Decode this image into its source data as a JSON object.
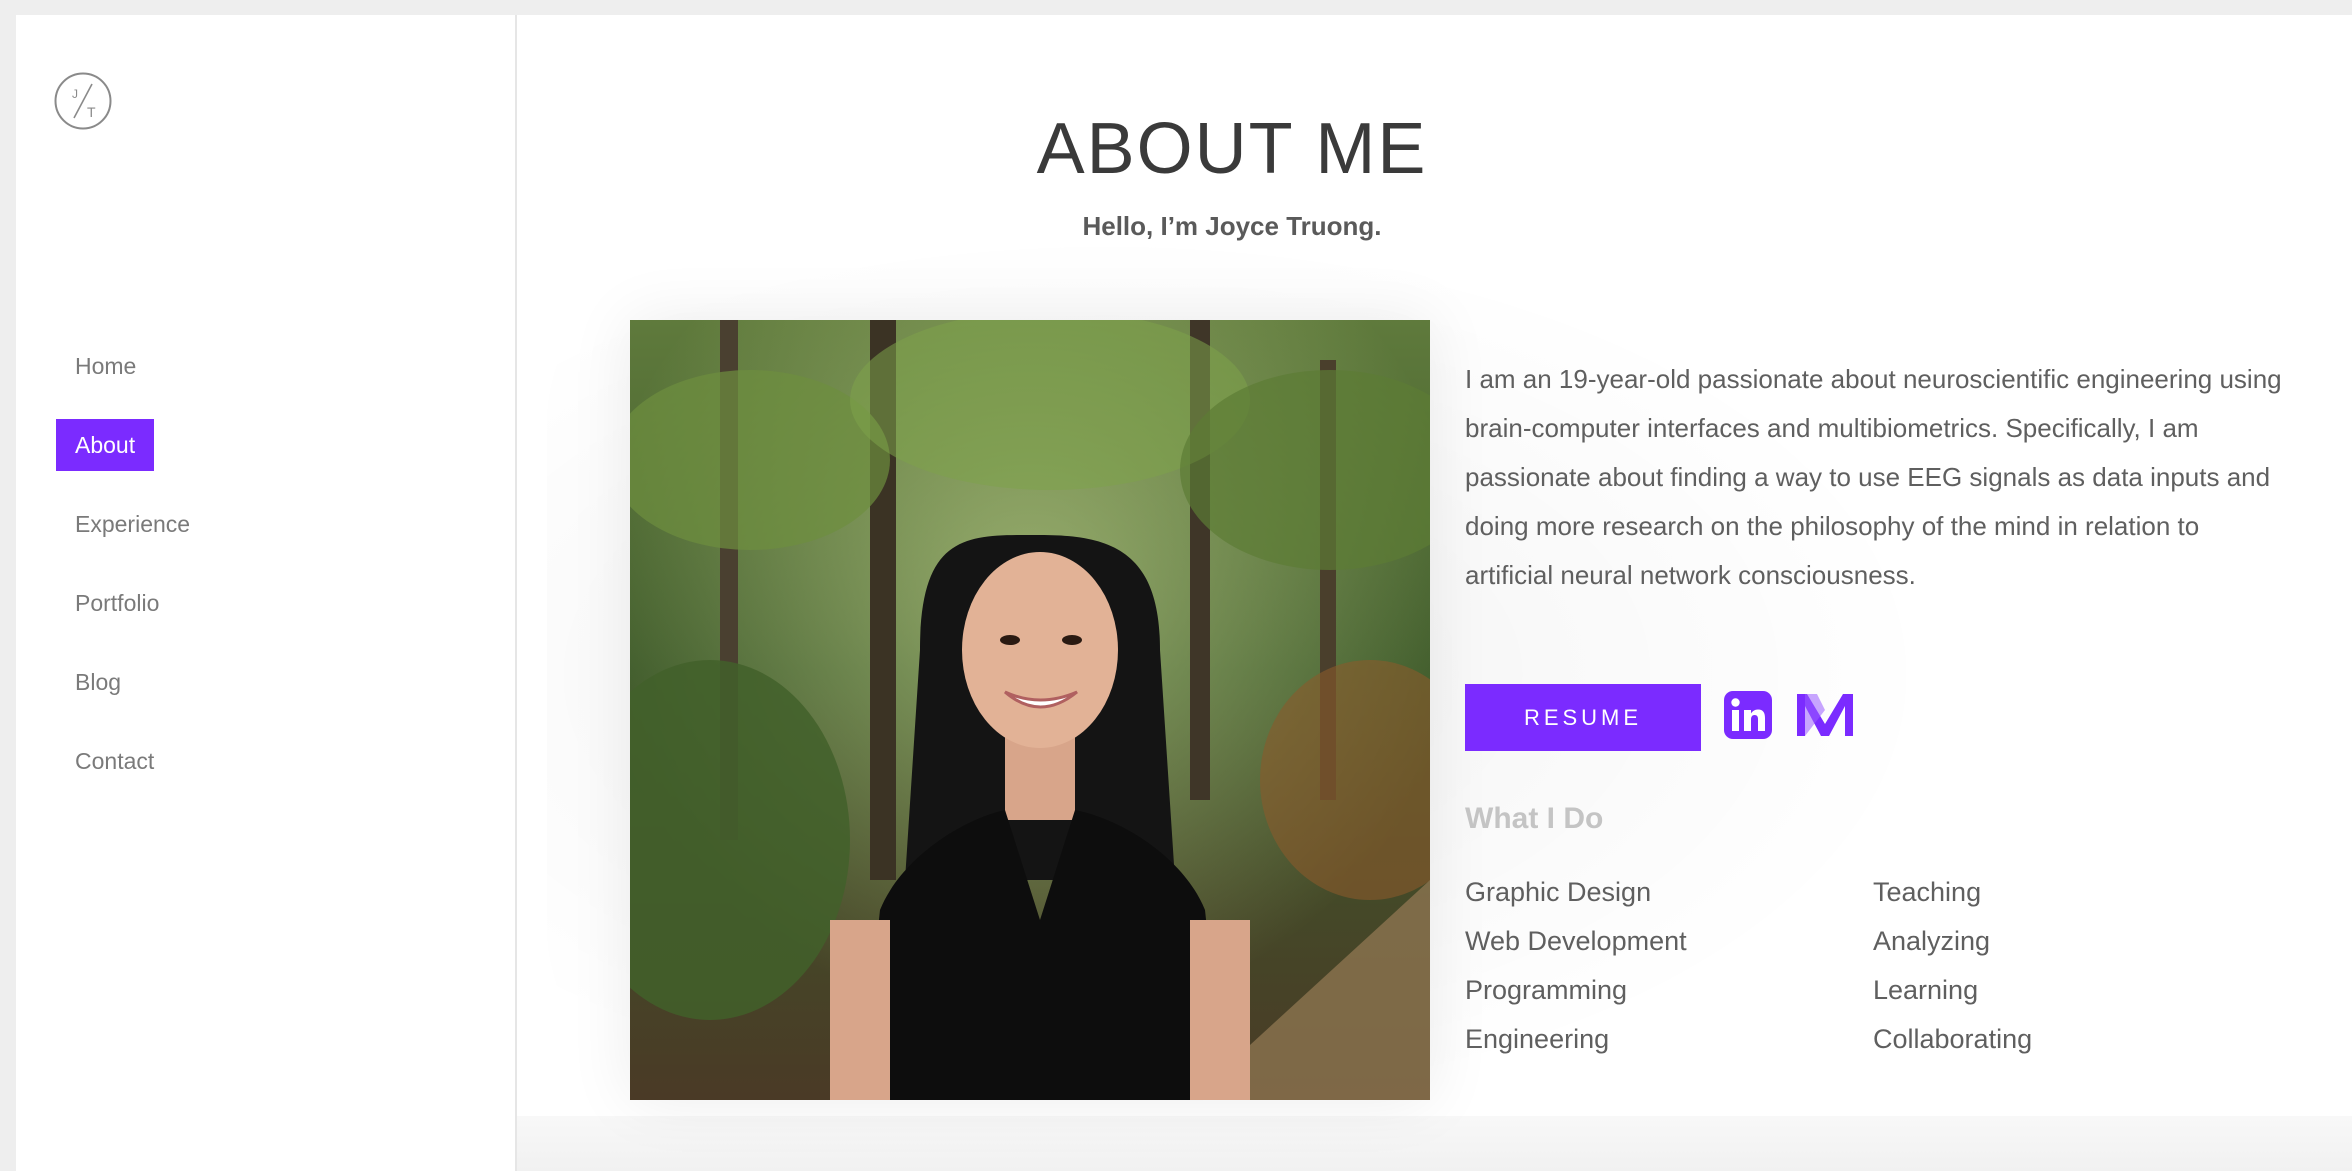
{
  "brand": {
    "logo_initials": [
      "J",
      "T"
    ]
  },
  "nav": {
    "items": [
      {
        "label": "Home"
      },
      {
        "label": "About",
        "active": true
      },
      {
        "label": "Experience"
      },
      {
        "label": "Portfolio"
      },
      {
        "label": "Blog"
      },
      {
        "label": "Contact"
      }
    ]
  },
  "about": {
    "title": "ABOUT ME",
    "greeting": "Hello, I’m Joyce Truong.",
    "bio": "I am an 19-year-old passionate about neuroscientific engineering using brain-computer interfaces and multibiometrics. Specifically, I am passionate about finding a way to use EEG signals as data inputs and doing more research on the philosophy of the mind in relation to artificial neural network consciousness.",
    "resume_label": "RESUME",
    "social_icons": [
      "linkedin-icon",
      "medium-icon"
    ],
    "what_i_do_title": "What I Do",
    "skills": [
      [
        "Graphic Design",
        "Teaching"
      ],
      [
        "Web Development",
        "Analyzing"
      ],
      [
        "Programming",
        "Learning"
      ],
      [
        "Engineering",
        "Collaborating"
      ]
    ]
  },
  "colors": {
    "accent": "#7b2bff",
    "nav_text": "#7a7a7a",
    "body_text": "#5f5f5f",
    "muted_heading": "#c4c4c4"
  }
}
